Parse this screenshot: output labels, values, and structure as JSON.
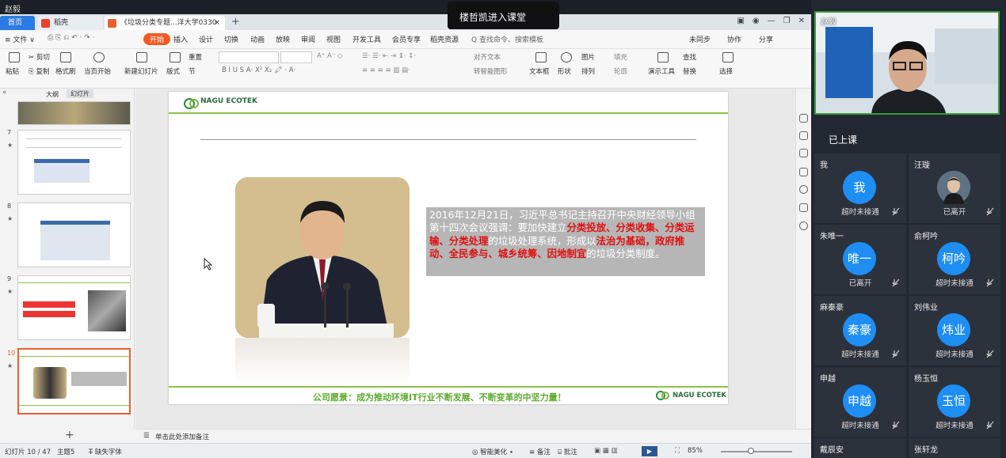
{
  "top_user": "赵毅",
  "window": {
    "tab_home": "首页",
    "tab_doc": "稻壳",
    "tab_ppt": "《垃圾分类专题...洋大学0330",
    "tab_close": "×",
    "tab_add": "+",
    "win_buttons": [
      "▣",
      "◉",
      "—",
      "❐",
      "✕"
    ]
  },
  "menubar": {
    "file": "≡ 文件 ∨",
    "items": [
      "开始",
      "插入",
      "设计",
      "切换",
      "动画",
      "放映",
      "审阅",
      "视图",
      "开发工具",
      "会员专享",
      "稻壳资源"
    ],
    "search": "Q 查找命令、搜索模板",
    "right": [
      "未同步",
      "协作",
      "分享"
    ]
  },
  "toolbar": {
    "paste": "粘贴",
    "cut": "剪切",
    "copy": "复制",
    "format_painter": "格式刷",
    "play_from_current": "当页开始",
    "new_slide": "新建幻灯片",
    "layout": "版式",
    "reset": "重置",
    "section": "节",
    "format_buttons": "B I U S A· X² X₂ 🖍 · A·",
    "text_direction": "对齐文本",
    "smart_graphic": "转智能图形",
    "textbox": "文本框",
    "shape": "形状",
    "picture": "图片",
    "fill": "填充",
    "arrange": "排列",
    "outline": "轮廓",
    "presentation_tools": "演示工具",
    "find": "查找",
    "replace": "替换",
    "select": "选择"
  },
  "leftpane": {
    "outline_tab": "大纲",
    "slides_tab": "幻灯片",
    "thumbnails": [
      {
        "num": "7"
      },
      {
        "num": "8"
      },
      {
        "num": "9"
      },
      {
        "num": "10"
      }
    ],
    "add": "+"
  },
  "slide": {
    "logo_text": "NAGU ECOTEK",
    "quote_prefix": "2016年12月21日，习近平总书记主持召开中央财经领导小组第十四次会议强调：要加快建立",
    "quote_red1": "分类投放、分类收集、分类运输、分类处理",
    "quote_mid": "的垃圾处理系统，形成以",
    "quote_red2": "法治为基础，政府推动、全民参与、城乡统筹、因地制宜",
    "quote_suffix": "的垃圾分类制度。",
    "vision": "公司愿景：成为推动环境IT行业不断发展、不断变革的中坚力量！"
  },
  "notes_placeholder": "单击此处添加备注",
  "statusbar": {
    "slide_index": "幻灯片 10 / 47",
    "theme": "主题5",
    "missing_font": "缺失字体",
    "beautify": "智能美化",
    "notes": "备注",
    "comments": "批注",
    "zoom": "85%"
  },
  "notification": "楼哲凯进入课堂",
  "meeting": {
    "video_name": "赵毅",
    "class_status": "已上课",
    "participants": [
      {
        "name": "我",
        "avatar": "我",
        "status": "超时未接通"
      },
      {
        "name": "汪璇",
        "avatar": "",
        "status": "已离开"
      },
      {
        "name": "朱唯一",
        "avatar": "唯一",
        "status": "已离开"
      },
      {
        "name": "俞柯吟",
        "avatar": "柯吟",
        "status": "超时未接通"
      },
      {
        "name": "麻秦豪",
        "avatar": "秦豪",
        "status": "超时未接通"
      },
      {
        "name": "刘伟业",
        "avatar": "炜业",
        "status": "超时未接通"
      },
      {
        "name": "申越",
        "avatar": "申越",
        "status": "超时未接通"
      },
      {
        "name": "杨玉恒",
        "avatar": "玉恒",
        "status": "超时未接通"
      },
      {
        "name": "戴辰安",
        "avatar": "",
        "status": ""
      },
      {
        "name": "张轩龙",
        "avatar": "",
        "status": ""
      }
    ]
  }
}
